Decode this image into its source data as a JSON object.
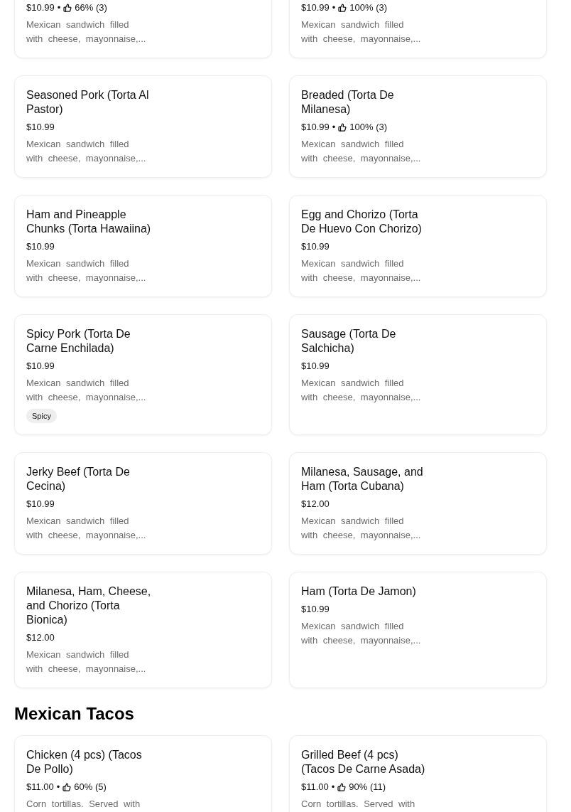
{
  "sections": [
    {
      "items": [
        {
          "price": "$10.99",
          "separator": "•",
          "rating": "66% (3)",
          "description": "Mexican sandwich filled with cheese, mayonnaise,..."
        },
        {
          "price": "$10.99",
          "separator": "•",
          "rating": "100% (3)",
          "description": "Mexican sandwich filled with cheese, mayonnaise,..."
        },
        {
          "name": "Seasoned Pork (Torta Al Pastor)",
          "price": "$10.99",
          "description": "Mexican sandwich filled with cheese, mayonnaise,..."
        },
        {
          "name": "Breaded (Torta De Milanesa)",
          "price": "$10.99",
          "separator": "•",
          "rating": "100% (3)",
          "description": "Mexican sandwich filled with cheese, mayonnaise,..."
        },
        {
          "name": "Ham and Pineapple Chunks (Torta Hawaiina)",
          "price": "$10.99",
          "description": "Mexican sandwich filled with cheese, mayonnaise,..."
        },
        {
          "name": "Egg and Chorizo (Torta De Huevo Con Chorizo)",
          "price": "$10.99",
          "description": "Mexican sandwich filled with cheese, mayonnaise,..."
        },
        {
          "name": "Spicy Pork (Torta De Carne Enchilada)",
          "price": "$10.99",
          "description": "Mexican sandwich filled with cheese, mayonnaise,...",
          "tags": [
            "Spicy"
          ]
        },
        {
          "name": "Sausage (Torta De Salchicha)",
          "price": "$10.99",
          "description": "Mexican sandwich filled with cheese, mayonnaise,..."
        },
        {
          "name": "Jerky Beef (Torta De Cecina)",
          "price": "$10.99",
          "description": "Mexican sandwich filled with cheese, mayonnaise,..."
        },
        {
          "name": "Milanesa, Sausage, and Ham (Torta Cubana)",
          "price": "$12.00",
          "description": "Mexican sandwich filled with cheese, mayonnaise,..."
        },
        {
          "name": "Milanesa, Ham, Cheese, and Chorizo (Torta Bionica)",
          "price": "$12.00",
          "description": "Mexican sandwich filled with cheese, mayonnaise,..."
        },
        {
          "name": "Ham (Torta De Jamon)",
          "price": "$10.99",
          "description": "Mexican sandwich filled with cheese, mayonnaise,..."
        }
      ]
    },
    {
      "title": "Mexican Tacos",
      "items": [
        {
          "name": "Chicken (4 pcs) (Tacos De Pollo)",
          "price": "$11.00",
          "separator": "•",
          "rating": "60% (5)",
          "description": "Corn tortillas. Served with"
        },
        {
          "name": "Grilled Beef (4 pcs) (Tacos De Carne Asada)",
          "price": "$11.00",
          "separator": "•",
          "rating": "90% (11)",
          "description": "Corn tortillas. Served with"
        }
      ]
    }
  ]
}
